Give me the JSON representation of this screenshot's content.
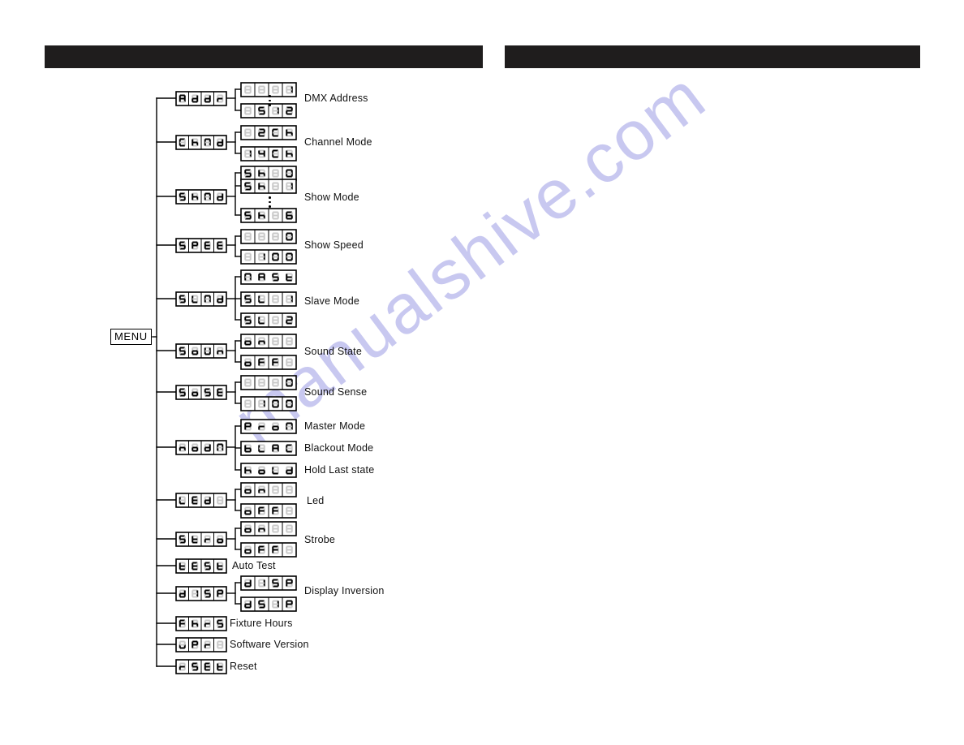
{
  "page": {
    "background": "#ffffff",
    "header_bar_color": "#1f1d1d",
    "watermark_text": "manualshive.com",
    "watermark_color": "#c8c8f0"
  },
  "header": {
    "left_bar_label": "",
    "right_bar_label": ""
  },
  "menu": {
    "root_label": "MENU"
  },
  "tree": {
    "items": [
      {
        "id": "addr",
        "code": "Addr",
        "code_cells": [
          "A",
          "d",
          "d",
          "r"
        ],
        "caption": "DMX Address",
        "values": [
          {
            "cells": [
              " ",
              " ",
              " ",
              "1"
            ],
            "text": "1"
          },
          {
            "cells": [
              " ",
              "5",
              "1",
              "2"
            ],
            "text": "512"
          }
        ],
        "has_ellipsis": true
      },
      {
        "id": "chnd",
        "code": "ChNd",
        "code_cells": [
          "C",
          "h",
          "N",
          "d"
        ],
        "caption": "Channel Mode",
        "values": [
          {
            "cells": [
              " ",
              "2",
              "C",
              "h"
            ],
            "text": "2Ch"
          },
          {
            "cells": [
              "1",
              "4",
              "C",
              "h"
            ],
            "text": "14Ch"
          }
        ],
        "has_ellipsis": false
      },
      {
        "id": "shnd",
        "code": "ShNd",
        "code_cells": [
          "S",
          "h",
          "N",
          "d"
        ],
        "caption": "Show Mode",
        "values": [
          {
            "cells": [
              "S",
              "h",
              " ",
              "0"
            ],
            "text": "Sh 0"
          },
          {
            "cells": [
              "S",
              "h",
              " ",
              "1"
            ],
            "text": "Sh 1"
          },
          {
            "cells": [
              "S",
              "h",
              " ",
              "6"
            ],
            "text": "Sh 6"
          }
        ],
        "has_ellipsis": true
      },
      {
        "id": "spee",
        "code": "SPEE",
        "code_cells": [
          "S",
          "P",
          "E",
          "E"
        ],
        "caption": "Show Speed",
        "values": [
          {
            "cells": [
              " ",
              " ",
              " ",
              "0"
            ],
            "text": "0"
          },
          {
            "cells": [
              " ",
              "1",
              "0",
              "0"
            ],
            "text": "100"
          }
        ],
        "has_ellipsis": false
      },
      {
        "id": "slnd",
        "code": "SLNd",
        "code_cells": [
          "S",
          "L",
          "N",
          "d"
        ],
        "caption": "Slave Mode",
        "values": [
          {
            "cells": [
              "N",
              "A",
              "S",
              "t"
            ],
            "text": "NASt",
            "nodivider": true
          },
          {
            "cells": [
              "S",
              "L",
              " ",
              "1"
            ],
            "text": "SL 1"
          },
          {
            "cells": [
              "S",
              "L",
              " ",
              "2"
            ],
            "text": "SL 2"
          }
        ],
        "has_ellipsis": false
      },
      {
        "id": "soun",
        "code": "SoUn",
        "code_cells": [
          "S",
          "o",
          "U",
          "n"
        ],
        "caption": "Sound State",
        "values": [
          {
            "cells": [
              "o",
              "n",
              " ",
              " "
            ],
            "text": "on"
          },
          {
            "cells": [
              "o",
              "F",
              "F",
              " "
            ],
            "text": "oFF"
          }
        ],
        "has_ellipsis": false
      },
      {
        "id": "sose",
        "code": "SoSE",
        "code_cells": [
          "S",
          "o",
          "S",
          "E"
        ],
        "caption": "Sound Sense",
        "values": [
          {
            "cells": [
              " ",
              " ",
              " ",
              "0"
            ],
            "text": "0"
          },
          {
            "cells": [
              " ",
              "1",
              "0",
              "0"
            ],
            "text": "100"
          }
        ],
        "has_ellipsis": false
      },
      {
        "id": "nodn",
        "code": "nodN",
        "code_cells": [
          "n",
          "o",
          "d",
          "N"
        ],
        "caption": "",
        "values": [
          {
            "cells": [
              "P",
              "r",
              "o",
              "N"
            ],
            "text": "Pron",
            "caption": "Master Mode",
            "nodivider": true
          },
          {
            "cells": [
              "b",
              "L",
              "A",
              "C"
            ],
            "text": "bLAC",
            "caption": "Blackout Mode",
            "nodivider": true
          },
          {
            "cells": [
              "h",
              "o",
              "L",
              "d"
            ],
            "text": "hoLd",
            "caption": "Hold Last state",
            "nodivider": true
          }
        ],
        "has_ellipsis": false
      },
      {
        "id": "led",
        "code": "LEd",
        "code_cells": [
          "L",
          "E",
          "d",
          " "
        ],
        "caption": "Led",
        "values": [
          {
            "cells": [
              "o",
              "n",
              " ",
              " "
            ],
            "text": "on"
          },
          {
            "cells": [
              "o",
              "F",
              "F",
              " "
            ],
            "text": "oFF"
          }
        ],
        "has_ellipsis": false
      },
      {
        "id": "stro",
        "code": "Stro",
        "code_cells": [
          "S",
          "t",
          "r",
          "o"
        ],
        "caption": "Strobe",
        "values": [
          {
            "cells": [
              "o",
              "n",
              " ",
              " "
            ],
            "text": "on"
          },
          {
            "cells": [
              "o",
              "F",
              "F",
              " "
            ],
            "text": "oFF"
          }
        ],
        "has_ellipsis": false
      },
      {
        "id": "test",
        "code": "tESt",
        "code_cells": [
          "t",
          "E",
          "S",
          "t"
        ],
        "caption": "Auto Test",
        "values": [],
        "has_ellipsis": false
      },
      {
        "id": "disp",
        "code": "d ISP",
        "code_cells": [
          "d",
          "1",
          "S",
          "P"
        ],
        "caption": "Display Inversion",
        "values": [
          {
            "cells": [
              "d",
              "1",
              "S",
              "P"
            ],
            "text": "d ISP"
          },
          {
            "cells": [
              "d",
              "S",
              "1",
              "P"
            ],
            "text": "dS IP"
          }
        ],
        "has_ellipsis": false
      },
      {
        "id": "fhrs",
        "code": "FhrS",
        "code_cells": [
          "F",
          "h",
          "r",
          "S"
        ],
        "caption": "Fixture Hours",
        "values": [],
        "has_ellipsis": false
      },
      {
        "id": "upr",
        "code": "uPr",
        "code_cells": [
          "u",
          "P",
          "r",
          " "
        ],
        "caption": "Software Version",
        "values": [],
        "has_ellipsis": false
      },
      {
        "id": "rset",
        "code": "rSEt",
        "code_cells": [
          "r",
          "S",
          "E",
          "t"
        ],
        "caption": "Reset",
        "values": [],
        "has_ellipsis": false
      }
    ]
  }
}
